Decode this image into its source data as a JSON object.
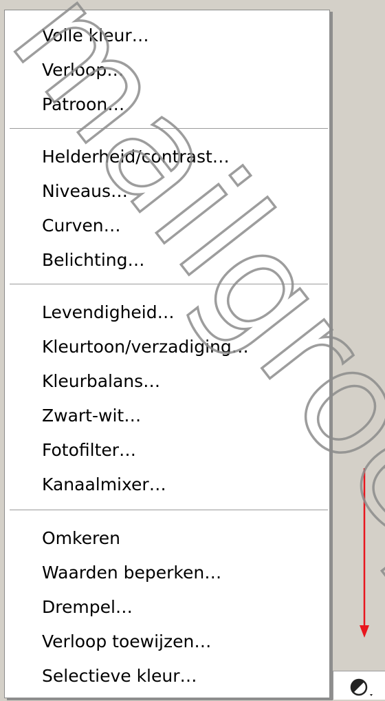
{
  "menu": {
    "groups": [
      {
        "items": [
          "Volle kleur…",
          "Verloop…",
          "Patroon…"
        ]
      },
      {
        "items": [
          "Helderheid/contrast…",
          "Niveaus…",
          "Curven…",
          "Belichting…"
        ]
      },
      {
        "items": [
          "Levendigheid…",
          "Kleurtoon/verzadiging…",
          "Kleurbalans…",
          "Zwart-wit…",
          "Fotofilter…",
          "Kanaalmixer…"
        ]
      },
      {
        "items": [
          "Omkeren",
          "Waarden beperken…",
          "Drempel…",
          "Verloop toewijzen…",
          "Selectieve kleur…"
        ]
      }
    ]
  },
  "watermark": {
    "text": "mailgroep",
    "color": "#8c8c8c"
  },
  "annotation": {
    "arrow_color": "#e8161e",
    "arrow_direction": "down"
  },
  "footer": {
    "adjustment_icon": "half-circle-adjustment-icon"
  }
}
